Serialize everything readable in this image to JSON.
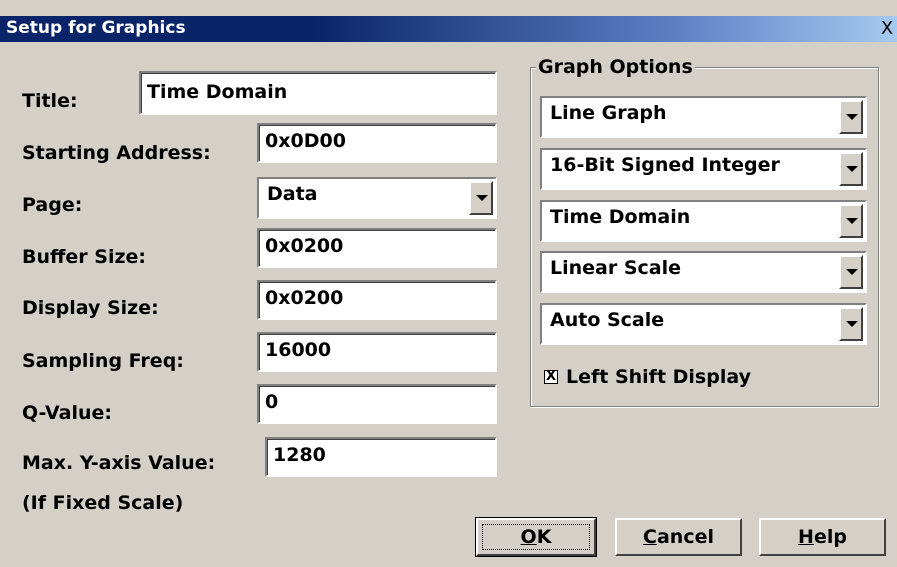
{
  "dialog": {
    "title": "Setup for Graphics",
    "close_glyph": "X"
  },
  "form": {
    "title_label": "Title:",
    "title_value": "Time Domain",
    "start_label": "Starting Address:",
    "start_value": "0x0D00",
    "page_label": "Page:",
    "page_value": "Data",
    "buffer_label": "Buffer Size:",
    "buffer_value": "0x0200",
    "display_label": "Display Size:",
    "display_value": "0x0200",
    "freq_label": "Sampling Freq:",
    "freq_value": "16000",
    "q_label": "Q-Value:",
    "q_value": "0",
    "ymax_label": "Max. Y-axis Value:",
    "ymax_value": "1280",
    "ymax_note": "(If Fixed Scale)"
  },
  "graph_options": {
    "label": "Graph Options",
    "graph_type": "Line Graph",
    "data_type": "16-Bit Signed Integer",
    "domain": "Time Domain",
    "scale_type": "Linear Scale",
    "scale_mode": "Auto Scale",
    "left_shift_label": "Left Shift Display",
    "left_shift_checked": "X"
  },
  "buttons": {
    "ok_u": "O",
    "ok_rest": "K",
    "cancel_u": "C",
    "cancel_rest": "ancel",
    "help_u": "H",
    "help_rest": "elp"
  }
}
